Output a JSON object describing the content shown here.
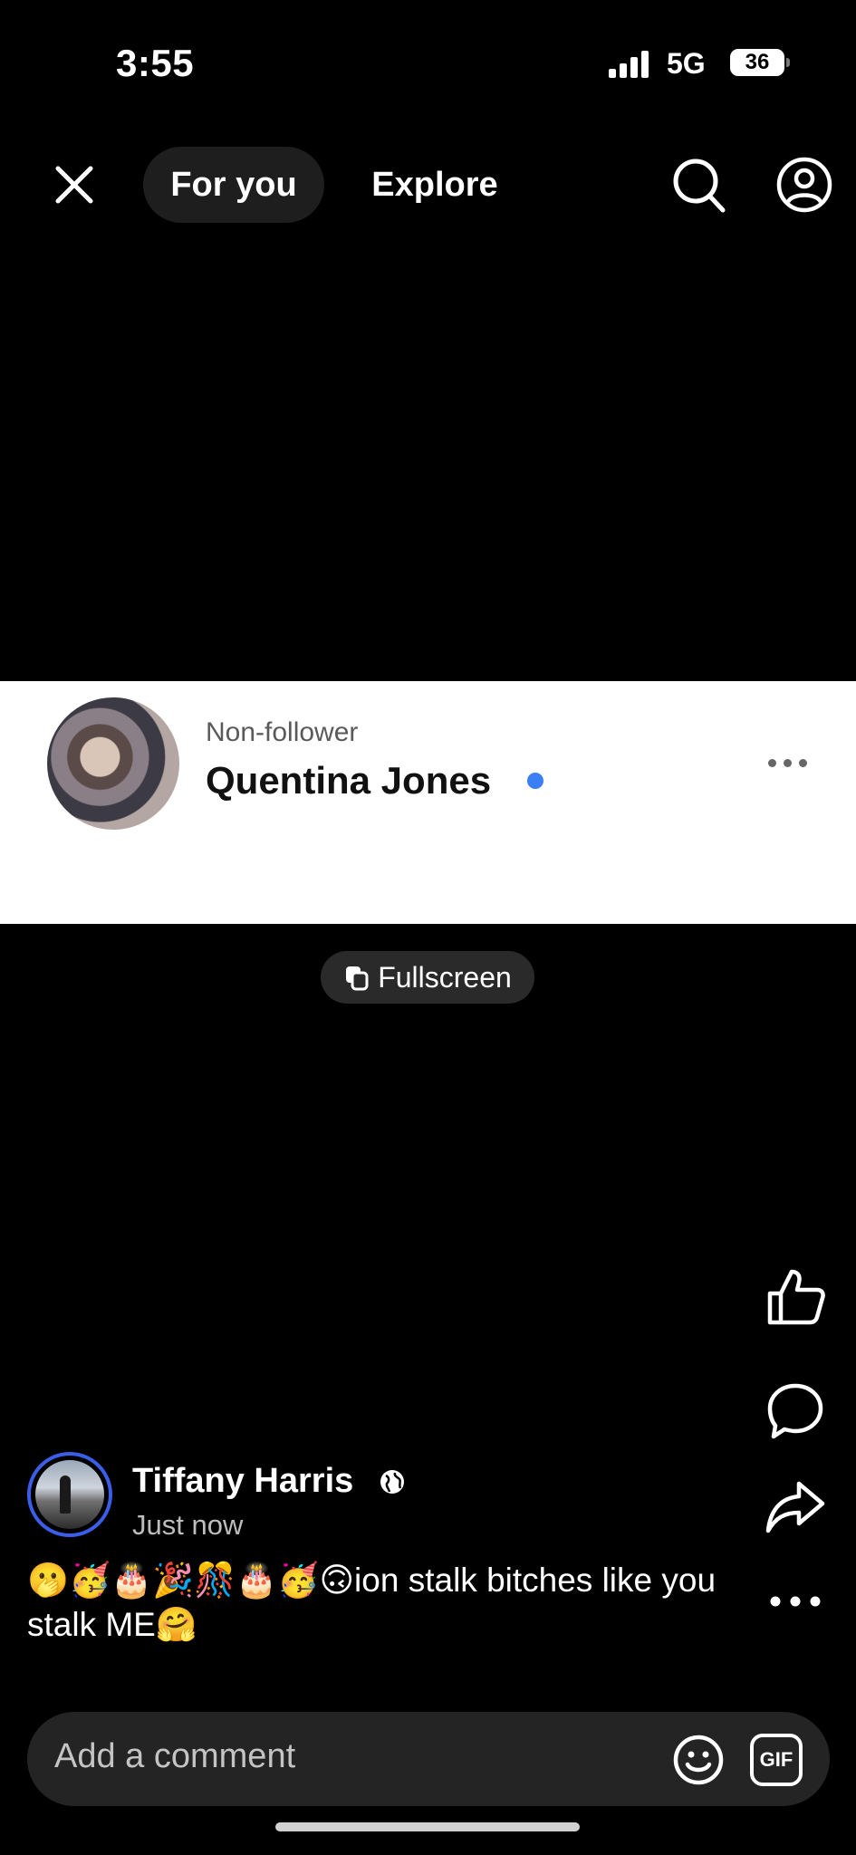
{
  "status_bar": {
    "time": "3:55",
    "network": "5G",
    "battery": "36"
  },
  "nav": {
    "tab_for_you": "For you",
    "tab_explore": "Explore"
  },
  "card": {
    "subtitle": "Non-follower",
    "name": "Quentina Jones"
  },
  "fullscreen_label": "Fullscreen",
  "post": {
    "author": "Tiffany Harris",
    "time": "Just now",
    "caption": "🫢🥳🎂🎉🎊🎂🥳🙃ion stalk bitches like you stalk ME🤗"
  },
  "comment": {
    "placeholder": "Add a comment",
    "gif_label": "GIF"
  },
  "colors": {
    "accent": "#3b7ef5",
    "background": "#000000",
    "card": "#ffffff"
  },
  "icons": [
    "close-icon",
    "search-icon",
    "profile-icon",
    "more-icon",
    "fullscreen-icon",
    "like-icon",
    "comment-icon",
    "share-icon",
    "globe-icon",
    "emoji-icon",
    "gif-icon"
  ]
}
